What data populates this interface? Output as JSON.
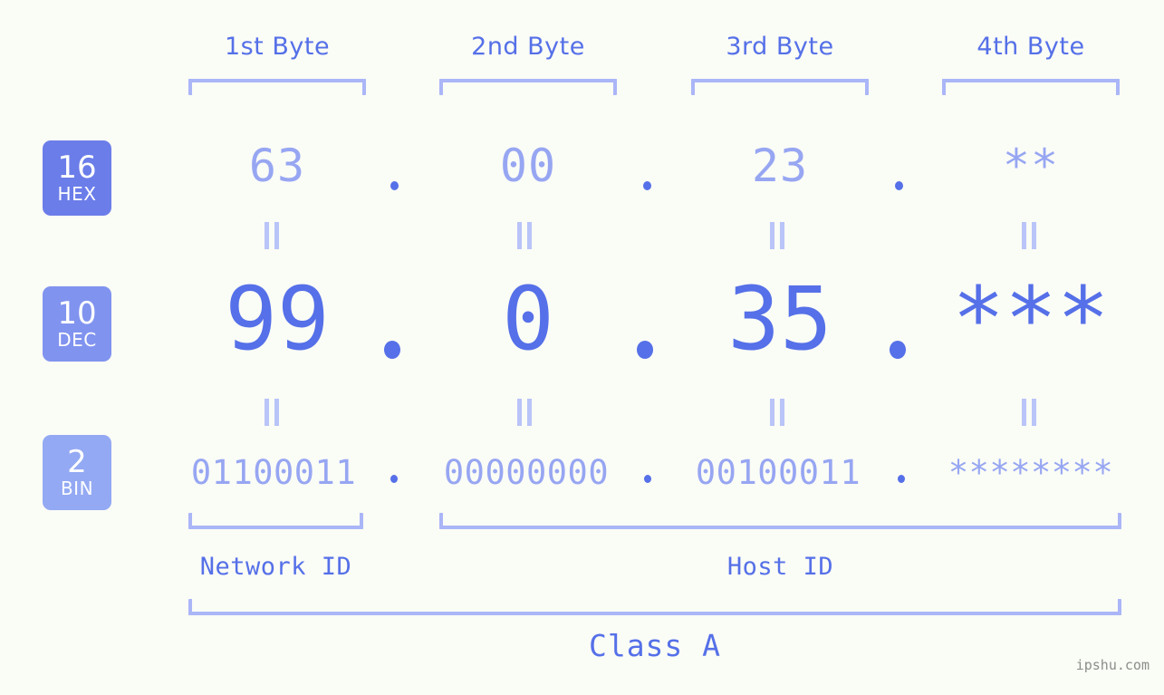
{
  "theme": {
    "background": "#fafcf6",
    "accent_strong": "#5570e8",
    "accent_light": "#97a6f2",
    "bracket": "#aab6f7",
    "eq_mark": "#b9c4f8",
    "badge_hex": "#6b7de9",
    "badge_dec": "#8093ef",
    "badge_bin": "#93a9f3",
    "badge_text": "#ffffff",
    "watermark_color": "#8a8f8a"
  },
  "byte_headers": [
    {
      "label": "1st Byte"
    },
    {
      "label": "2nd Byte"
    },
    {
      "label": "3rd Byte"
    },
    {
      "label": "4th Byte"
    }
  ],
  "bases": [
    {
      "number": "16",
      "name": "HEX"
    },
    {
      "number": "10",
      "name": "DEC"
    },
    {
      "number": "2",
      "name": "BIN"
    }
  ],
  "rows": {
    "hex": {
      "base_number": "16",
      "base_name": "HEX",
      "values": [
        "63",
        "00",
        "23",
        "**"
      ],
      "separator": "."
    },
    "dec": {
      "base_number": "10",
      "base_name": "DEC",
      "values": [
        "99",
        "0",
        "35",
        "***"
      ],
      "separator": "."
    },
    "bin": {
      "base_number": "2",
      "base_name": "BIN",
      "values": [
        "01100011",
        "00000000",
        "00100011",
        "********"
      ],
      "separator": "."
    }
  },
  "equals_marks": {
    "glyph": "||",
    "count_per_gap": 4
  },
  "segments": {
    "network_id": {
      "label": "Network ID"
    },
    "host_id": {
      "label": "Host ID"
    }
  },
  "class": {
    "label": "Class A"
  },
  "watermark": {
    "text": "ipshu.com"
  }
}
